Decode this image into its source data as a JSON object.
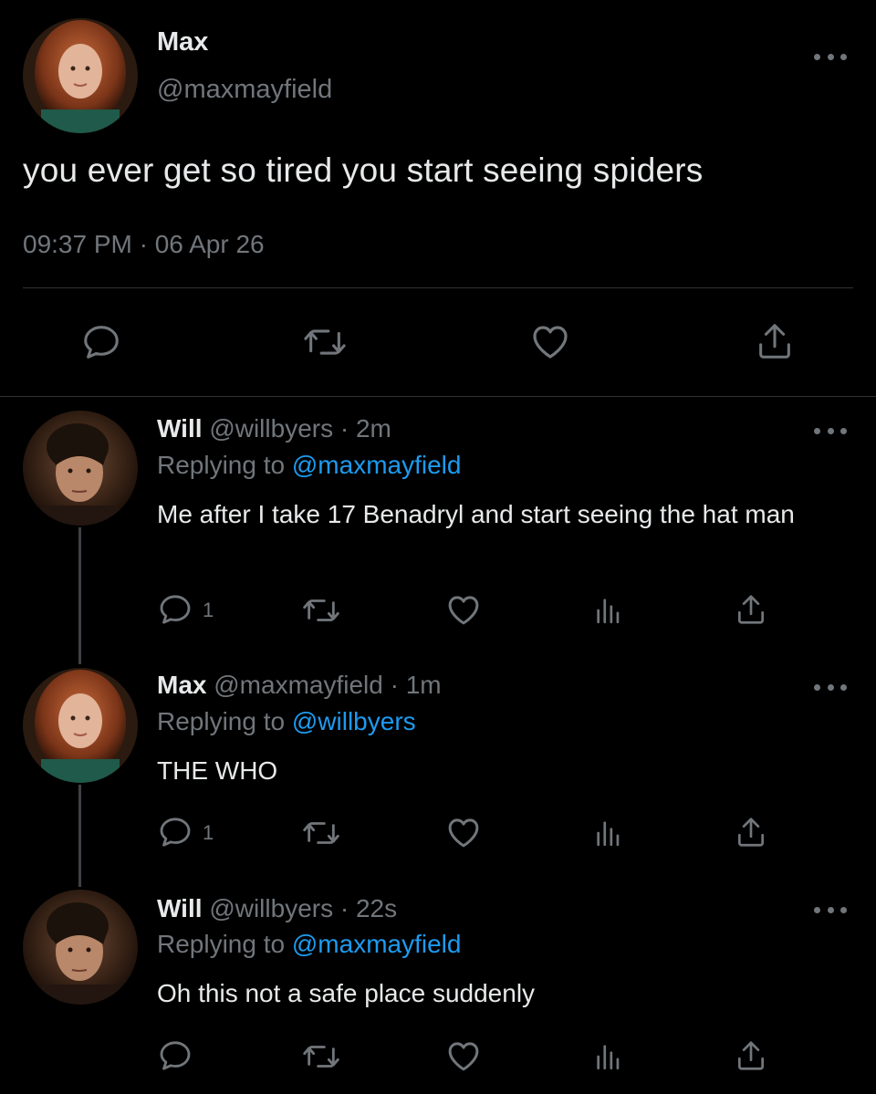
{
  "main_tweet": {
    "name": "Max",
    "handle": "@maxmayfield",
    "text": "you ever get so tired you start seeing spiders",
    "timestamp": "09:37 PM · 06 Apr 26",
    "icons": [
      "reply-icon",
      "retweet-icon",
      "like-icon",
      "share-icon"
    ]
  },
  "replies": [
    {
      "name": "Will",
      "handle_time": "@willbyers · 2m",
      "replying_prefix": "Replying to ",
      "replying_to": "@maxmayfield",
      "text": "Me after I take 17 Benadryl and start seeing the hat man",
      "reply_count": "1"
    },
    {
      "name": "Max",
      "handle_time": "@maxmayfield · 1m",
      "replying_prefix": "Replying to ",
      "replying_to": "@willbyers",
      "text": "THE WHO",
      "reply_count": "1"
    },
    {
      "name": "Will",
      "handle_time": "@willbyers · 22s",
      "replying_prefix": "Replying to ",
      "replying_to": "@maxmayfield",
      "text": "Oh this not a safe place suddenly",
      "reply_count": ""
    }
  ],
  "colors": {
    "background": "#000000",
    "text": "#e7e9ea",
    "muted": "#71767b",
    "link": "#1d9bf0",
    "divider": "#2f3336"
  }
}
